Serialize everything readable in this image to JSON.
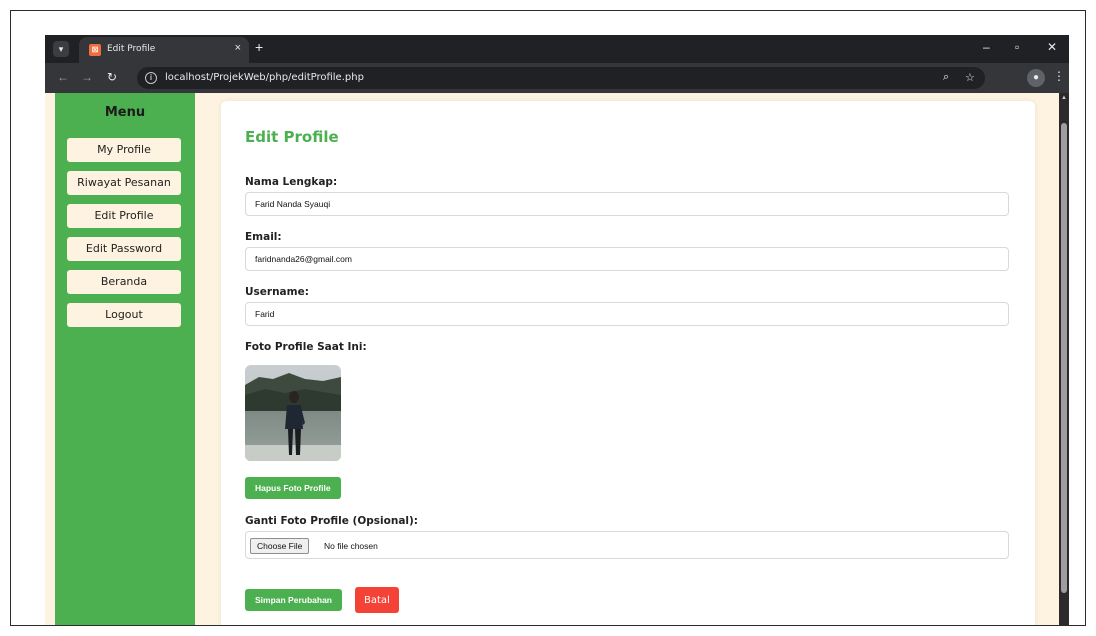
{
  "browser": {
    "tab_title": "Edit Profile",
    "tab_close": "×",
    "new_tab": "+",
    "url": "localhost/ProjekWeb/php/editProfile.php",
    "info_glyph": "i",
    "icons": {
      "tab_list": "chevron-down-icon",
      "favicon": "xampp-icon",
      "back": "arrow-left-icon",
      "forward": "arrow-right-icon",
      "reload": "reload-icon",
      "zoom": "zoom-icon",
      "bookmark": "star-icon",
      "profile": "profile-icon",
      "menu": "more-vertical-icon",
      "minimize": "minimize-icon",
      "maximize": "maximize-icon",
      "close": "close-icon"
    }
  },
  "sidebar": {
    "title": "Menu",
    "items": [
      {
        "label": "My Profile"
      },
      {
        "label": "Riwayat Pesanan"
      },
      {
        "label": "Edit Profile"
      },
      {
        "label": "Edit Password"
      },
      {
        "label": "Beranda"
      },
      {
        "label": "Logout"
      }
    ]
  },
  "form": {
    "title": "Edit Profile",
    "nama": {
      "label": "Nama Lengkap:",
      "value": "Farid Nanda Syauqi"
    },
    "email": {
      "label": "Email:",
      "value": "faridnanda26@gmail.com"
    },
    "username": {
      "label": "Username:",
      "value": "Farid"
    },
    "photo_label": "Foto Profile Saat Ini:",
    "delete_photo_label": "Hapus Foto Profile",
    "change_photo_label": "Ganti Foto Profile (Opsional):",
    "choose_file_label": "Choose File",
    "no_file_label": "No file chosen",
    "save_label": "Simpan Perubahan",
    "cancel_label": "Batal"
  },
  "colors": {
    "accent": "#4caf50",
    "danger": "#f44336",
    "background": "#fdf3e0"
  }
}
